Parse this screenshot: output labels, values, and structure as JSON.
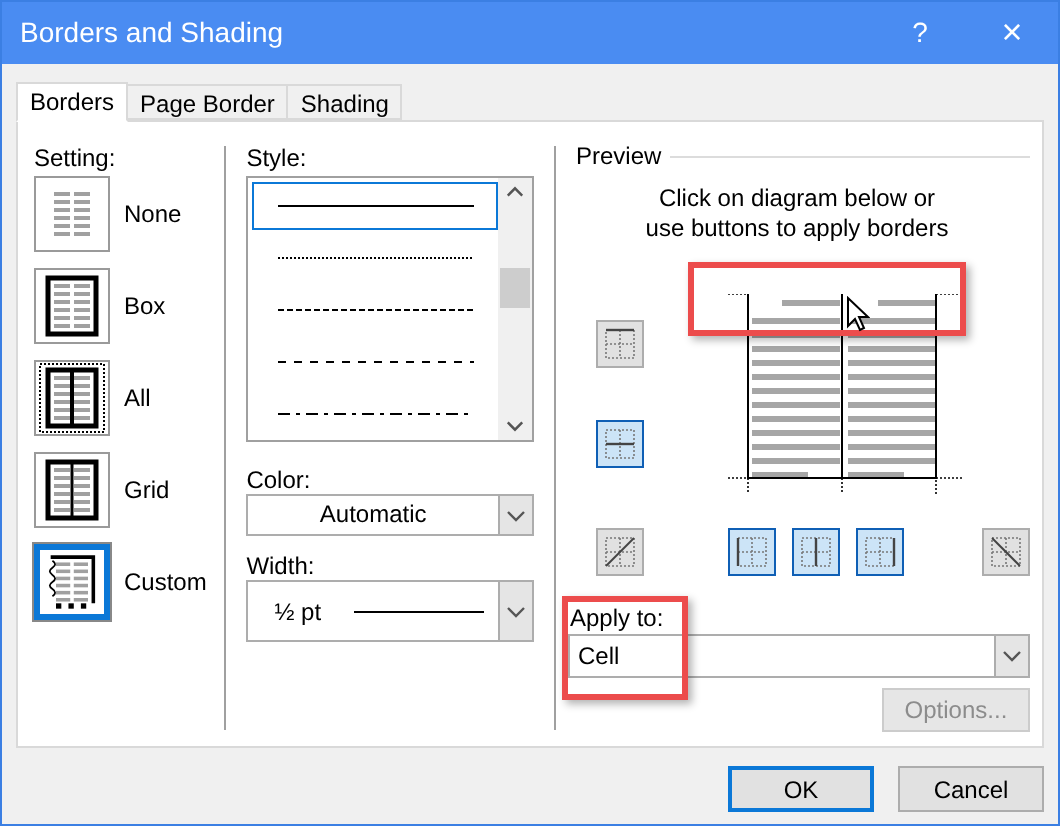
{
  "window": {
    "title": "Borders and Shading",
    "help": "?",
    "close": "×"
  },
  "tabs": [
    {
      "label": "Borders",
      "selected": true
    },
    {
      "label": "Page Border",
      "selected": false
    },
    {
      "label": "Shading",
      "selected": false
    }
  ],
  "setting": {
    "label": "Setting:",
    "options": [
      {
        "label": "None",
        "kind": "none",
        "selected": false
      },
      {
        "label": "Box",
        "kind": "box",
        "selected": false
      },
      {
        "label": "All",
        "kind": "all",
        "selected": false
      },
      {
        "label": "Grid",
        "kind": "grid",
        "selected": false
      },
      {
        "label": "Custom",
        "kind": "custom",
        "selected": true
      }
    ]
  },
  "style": {
    "label": "Style:",
    "options": [
      {
        "kind": "solid",
        "selected": true
      },
      {
        "kind": "dotted",
        "selected": false
      },
      {
        "kind": "dashed-small",
        "selected": false
      },
      {
        "kind": "dashed-large",
        "selected": false
      },
      {
        "kind": "dash-dot",
        "selected": false
      }
    ]
  },
  "color": {
    "label": "Color:",
    "value": "Automatic"
  },
  "width": {
    "label": "Width:",
    "value": "½ pt"
  },
  "preview": {
    "label": "Preview",
    "instructions": "Click on diagram below or\nuse buttons to apply borders",
    "side_buttons": [
      {
        "kind": "top",
        "selected": false
      },
      {
        "kind": "middle-h",
        "selected": true
      }
    ],
    "bottom_buttons": [
      {
        "kind": "diagonal-up",
        "selected": false
      },
      {
        "kind": "left",
        "selected": true
      },
      {
        "kind": "middle-v",
        "selected": true
      },
      {
        "kind": "right",
        "selected": true
      },
      {
        "kind": "diagonal-down",
        "selected": false
      }
    ]
  },
  "apply_to": {
    "label": "Apply to:",
    "value": "Cell"
  },
  "options_button": {
    "label": "Options...",
    "disabled": true
  },
  "buttons": [
    {
      "label": "OK",
      "default": true
    },
    {
      "label": "Cancel",
      "default": false
    }
  ]
}
